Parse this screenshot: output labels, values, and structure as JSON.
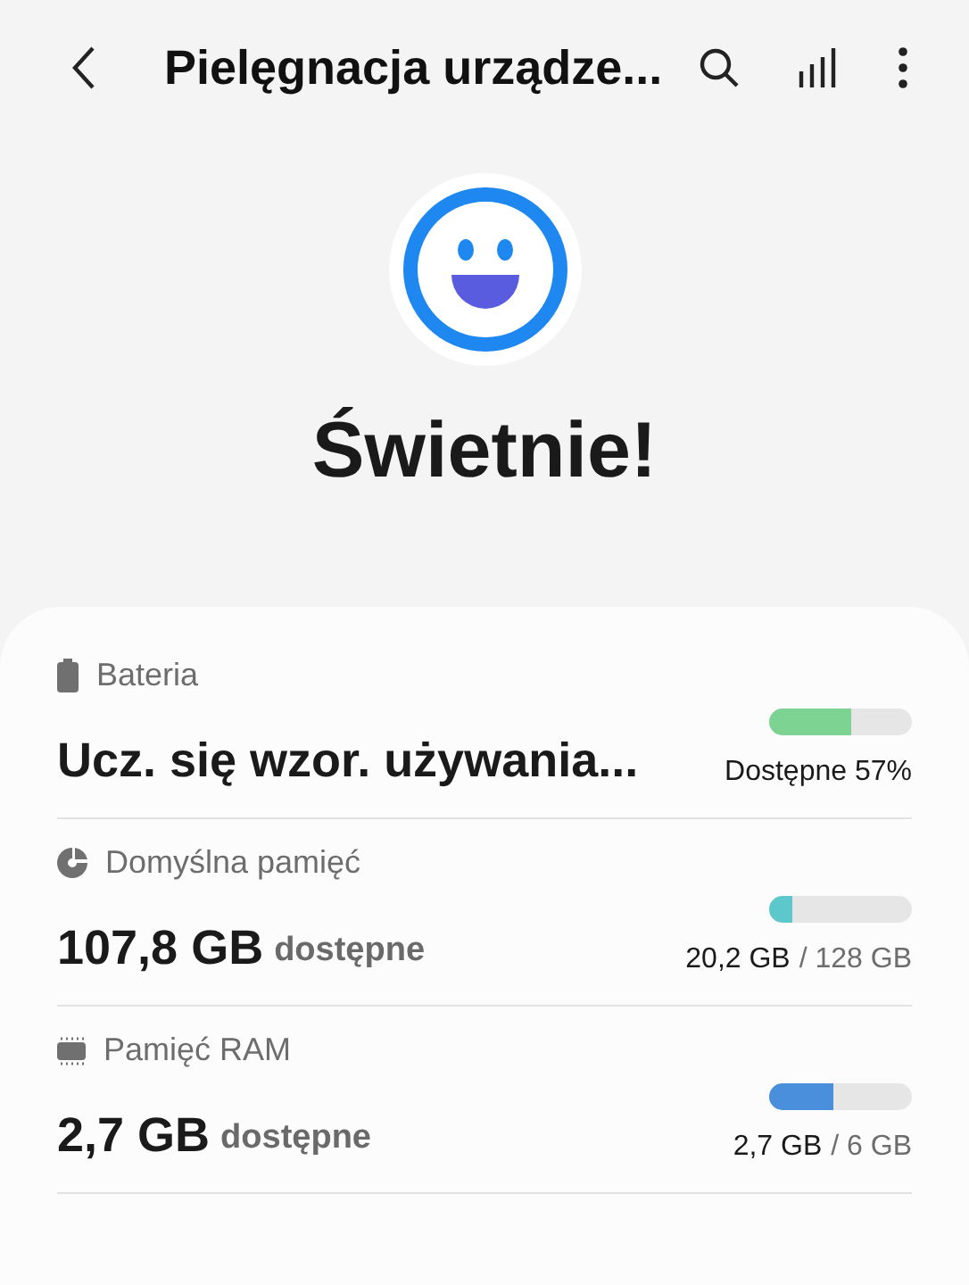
{
  "header": {
    "title": "Pielęgnacja urządze..."
  },
  "status": {
    "label": "Świetnie!"
  },
  "items": [
    {
      "kind": "battery",
      "label": "Bateria",
      "value": "Ucz. się wzor. używania...",
      "reading": "Dostępne 57%",
      "level": 0.57,
      "color": "#7dd391"
    },
    {
      "kind": "storage",
      "label": "Domyślna pamięć",
      "value": "107,8 GB",
      "unit": "dostępne",
      "reading": "20,2 GB",
      "reading_total": "/ 128 GB",
      "level": 0.16,
      "color": "#5cc8cc"
    },
    {
      "kind": "ram",
      "label": "Pamięć RAM",
      "value": "2,7 GB",
      "unit": "dostępne",
      "reading": "2,7 GB",
      "reading_total": "/ 6 GB",
      "level": 0.45,
      "color": "#4a8fdb"
    }
  ]
}
